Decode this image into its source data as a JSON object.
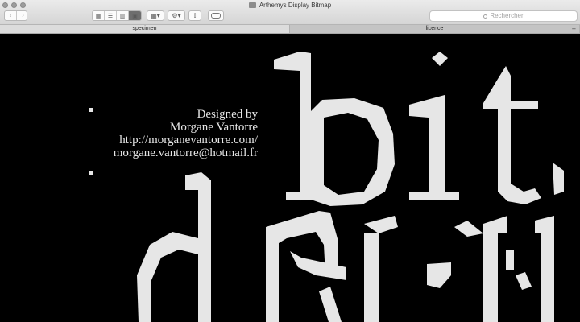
{
  "window": {
    "title": "Arthemys Display Bitmap"
  },
  "toolbar": {
    "back_icon": "chevron-left-icon",
    "forward_icon": "chevron-right-icon",
    "view_modes": [
      "icon-view-icon",
      "list-view-icon",
      "column-view-icon",
      "cover-flow-icon"
    ],
    "active_view": 3,
    "group_icon": "group-icon",
    "action_icon": "gear-icon",
    "share_icon": "share-icon",
    "tag_icon": "tag-icon",
    "search_placeholder": "Rechercher"
  },
  "tabs": [
    {
      "label": "specimen",
      "active": true
    },
    {
      "label": "licence",
      "active": false
    }
  ],
  "credits": {
    "line1": "Designed by",
    "line2": "Morgane Vantorre",
    "line3": "http://morganevantorre.com/",
    "line4": "morgane.vantorre@hotmail.fr"
  },
  "specimen": {
    "line1": "bit",
    "line2": "dpu"
  },
  "colors": {
    "background": "#000000",
    "glyph": "#e6e6e6"
  }
}
